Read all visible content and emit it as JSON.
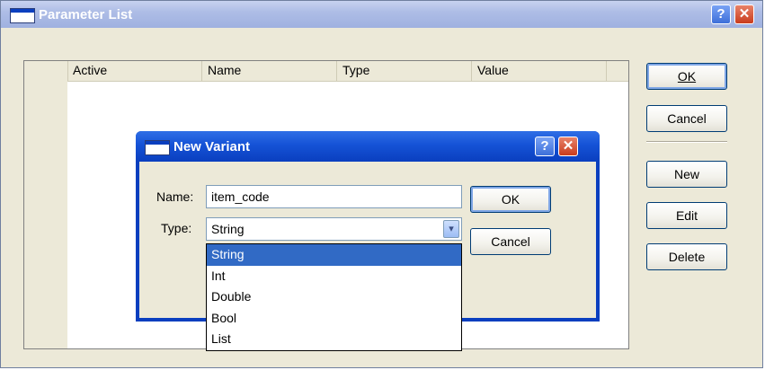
{
  "main_window": {
    "title": "Parameter List",
    "help_glyph": "?",
    "close_glyph": "✕",
    "columns": [
      "Active",
      "Name",
      "Type",
      "Value"
    ],
    "buttons": {
      "ok": "OK",
      "cancel": "Cancel",
      "new": "New",
      "edit": "Edit",
      "delete": "Delete"
    }
  },
  "dialog": {
    "title": "New Variant",
    "help_glyph": "?",
    "close_glyph": "✕",
    "name_label": "Name:",
    "name_value": "item_code",
    "type_label": "Type:",
    "type_value": "String",
    "dropdown_glyph": "▾",
    "ok": "OK",
    "cancel": "Cancel",
    "type_options": [
      "String",
      "Int",
      "Double",
      "Bool",
      "List"
    ],
    "selected_index": 0
  },
  "colors": {
    "xp_blue": "#0a3fbf",
    "selection": "#316ac5",
    "face": "#ece9d8"
  },
  "icons": [
    "window-icon",
    "help-icon",
    "close-icon",
    "dropdown-arrow-icon"
  ]
}
